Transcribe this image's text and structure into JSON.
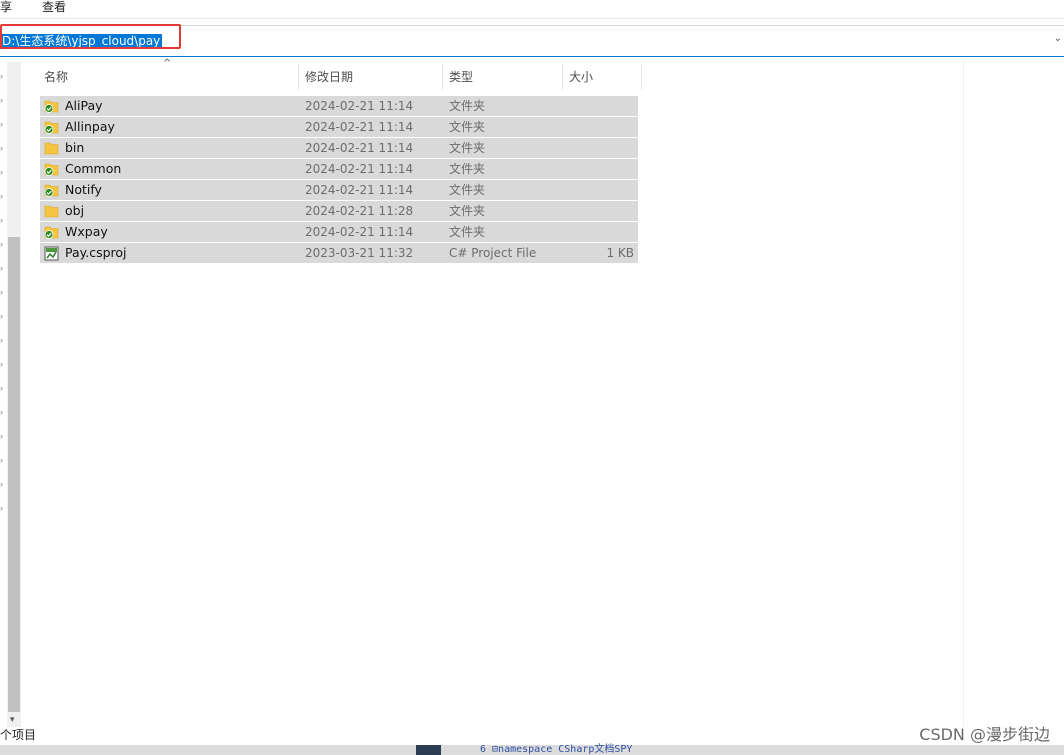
{
  "menu": {
    "share": "享",
    "view": "查看"
  },
  "address": {
    "path": "D:\\生态系统\\yjsp_cloud\\pay"
  },
  "columns": {
    "name": "名称",
    "date": "修改日期",
    "type": "类型",
    "size": "大小"
  },
  "files": [
    {
      "name": "AliPay",
      "date": "2024-02-21 11:14",
      "type": "文件夹",
      "size": "",
      "icon": "folder-synced-icon"
    },
    {
      "name": "Allinpay",
      "date": "2024-02-21 11:14",
      "type": "文件夹",
      "size": "",
      "icon": "folder-synced-icon"
    },
    {
      "name": "bin",
      "date": "2024-02-21 11:14",
      "type": "文件夹",
      "size": "",
      "icon": "folder-icon"
    },
    {
      "name": "Common",
      "date": "2024-02-21 11:14",
      "type": "文件夹",
      "size": "",
      "icon": "folder-synced-icon"
    },
    {
      "name": "Notify",
      "date": "2024-02-21 11:14",
      "type": "文件夹",
      "size": "",
      "icon": "folder-synced-icon"
    },
    {
      "name": "obj",
      "date": "2024-02-21 11:28",
      "type": "文件夹",
      "size": "",
      "icon": "folder-icon"
    },
    {
      "name": "Wxpay",
      "date": "2024-02-21 11:14",
      "type": "文件夹",
      "size": "",
      "icon": "folder-synced-icon"
    },
    {
      "name": "Pay.csproj",
      "date": "2023-03-21 11:32",
      "type": "C# Project File",
      "size": "1 KB",
      "icon": "csproj-file-icon"
    }
  ],
  "status": {
    "items": "个项目"
  },
  "background_code": "6 ⊟namespace CSharp文档SPY",
  "watermark": "CSDN @漫步街边",
  "colors": {
    "selection": "#0078d7",
    "row_highlight": "#d9d9d9",
    "annotation": "#e53935",
    "sync_check": "#2e8b1f",
    "folder": "#f5c542"
  }
}
